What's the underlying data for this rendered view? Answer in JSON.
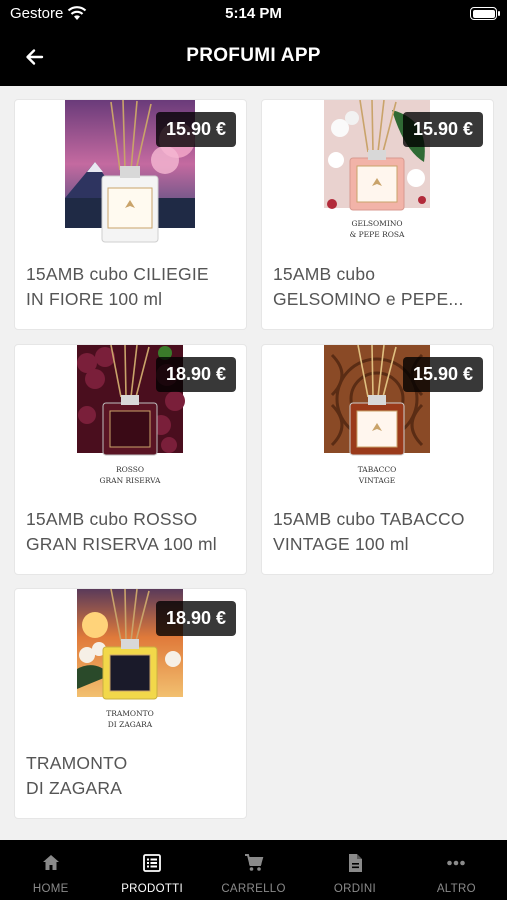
{
  "status_bar": {
    "carrier": "Gestore",
    "time": "5:14 PM"
  },
  "header": {
    "title": "PROFUMI APP"
  },
  "products": [
    {
      "name_line1": "15AMB cubo CILIEGIE",
      "name_line2": "IN FIORE 100 ml",
      "price": "15.90 €",
      "label_text": ""
    },
    {
      "name_line1": "15AMB cubo",
      "name_line2": "GELSOMINO e PEPE...",
      "price": "15.90 €",
      "label_text": "GELSOMINO & PEPE ROSA"
    },
    {
      "name_line1": "15AMB cubo ROSSO",
      "name_line2": "GRAN RISERVA 100 ml",
      "price": "18.90 €",
      "label_text": "ROSSO GRAN RISERVA"
    },
    {
      "name_line1": "15AMB cubo TABACCO",
      "name_line2": "VINTAGE 100 ml",
      "price": "15.90 €",
      "label_text": "TABACCO VINTAGE"
    },
    {
      "name_line1": "TRAMONTO",
      "name_line2": "DI ZAGARA",
      "price": "18.90 €",
      "label_text": "TRAMONTO DI ZAGARA"
    }
  ],
  "tabs": [
    {
      "label": "HOME",
      "icon": "home-icon",
      "active": false
    },
    {
      "label": "PRODOTTI",
      "icon": "list-icon",
      "active": true
    },
    {
      "label": "CARRELLO",
      "icon": "cart-icon",
      "active": false
    },
    {
      "label": "ORDINI",
      "icon": "document-icon",
      "active": false
    },
    {
      "label": "ALTRO",
      "icon": "more-icon",
      "active": false
    }
  ],
  "colors": {
    "bar_background": "#000000",
    "active_tab": "#ffffff",
    "inactive_tab": "#8a8a8a",
    "price_badge": "#000000"
  }
}
